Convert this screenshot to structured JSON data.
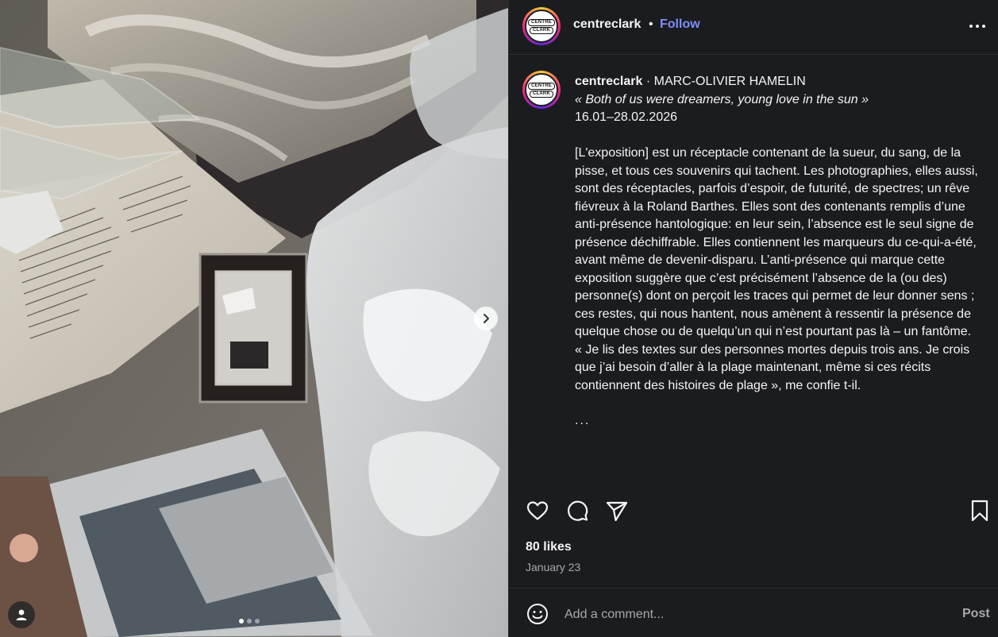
{
  "post": {
    "media": {
      "slide_count": 3,
      "active_slide": 1,
      "icons": {
        "next": "chevron-right-icon",
        "tagged_users": "user-icon"
      }
    },
    "header": {
      "username": "centreclark",
      "separator": "•",
      "follow_label": "Follow",
      "avatar_text_top": "CENTRE",
      "avatar_text_bottom": "CLARK",
      "more_icon": "more-horizontal-icon"
    },
    "caption": {
      "username": "centreclark",
      "headline": " · MARC-OLIVIER HAMELIN",
      "title": "« Both of us were dreamers, young love in the sun »",
      "dates": "16.01–28.02.2026",
      "body": "[L'exposition] est un réceptacle contenant de la sueur, du sang, de la pisse, et tous ces souvenirs qui tachent. Les photographies, elles aussi, sont des réceptacles, parfois d’espoir, de futurité, de spectres; un rêve fiévreux à la Roland Barthes. Elles sont des contenants remplis d’une anti-présence hantologique: en leur sein, l’absence est le seul signe de présence déchiffrable. Elles contiennent les marqueurs du ce-qui-a-été, avant même de devenir-disparu. L’anti-présence qui marque cette exposition suggère que c’est précisément l’absence de la (ou des) personne(s) dont on perçoit les traces qui permet de leur donner sens ; ces restes, qui nous hantent, nous amènent à ressentir la présence de quelque chose ou de quelqu’un qui n’est pourtant pas là – un fantôme. « Je lis des textes sur des personnes mortes depuis trois ans. Je crois que j’ai besoin d’aller à la plage maintenant, même si ces récits contiennent des histoires de plage », me confie t-il.",
      "ellipsis": "..."
    },
    "actions": {
      "like_icon": "heart-icon",
      "comment_icon": "comment-icon",
      "share_icon": "send-icon",
      "save_icon": "bookmark-icon"
    },
    "likes_text": "80 likes",
    "date_text": "January 23",
    "comment_box": {
      "emoji_icon": "smiley-icon",
      "placeholder": "Add a comment...",
      "post_label": "Post"
    }
  }
}
